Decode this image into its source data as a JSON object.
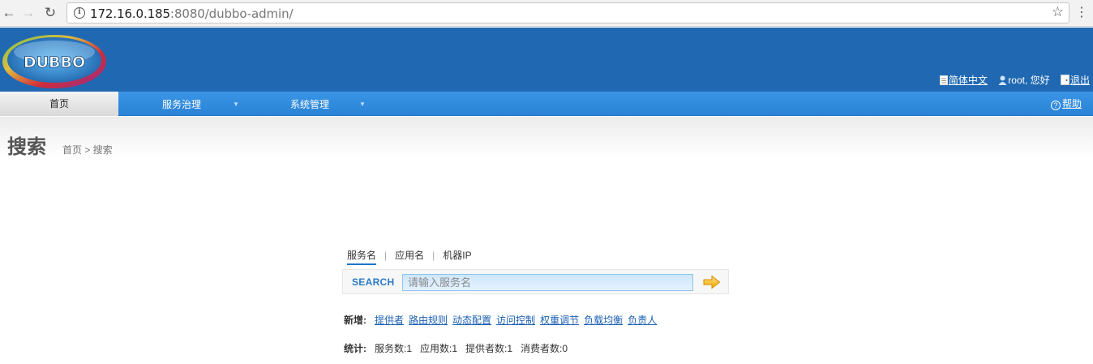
{
  "browser": {
    "url_host": "172.16.0.185",
    "url_rest": ":8080/dubbo-admin/"
  },
  "header": {
    "logo_text": "DUBBO",
    "lang_link": "简体中文",
    "user_greeting": "root, 您好",
    "logout_link": "退出"
  },
  "navbar": {
    "home": "首页",
    "items": [
      {
        "label": "服务治理"
      },
      {
        "label": "系统管理"
      }
    ],
    "help": "帮助"
  },
  "page": {
    "title": "搜索",
    "breadcrumb": "首页 > 搜索"
  },
  "search": {
    "tabs": [
      "服务名",
      "应用名",
      "机器IP"
    ],
    "label": "SEARCH",
    "placeholder": "请输入服务名",
    "value": ""
  },
  "add": {
    "label": "新增:",
    "links": [
      "提供者",
      "路由规则",
      "动态配置",
      "访问控制",
      "权重调节",
      "负载均衡",
      "负责人"
    ]
  },
  "stats": {
    "label": "统计:",
    "items": [
      "服务数:1",
      "应用数:1",
      "提供者数:1",
      "消费者数:0"
    ]
  },
  "colors": {
    "header_bg": "#2069b2",
    "navbar_bg": "#2a83d6",
    "link": "#1a5fb4",
    "search_label": "#2a7ac9"
  }
}
